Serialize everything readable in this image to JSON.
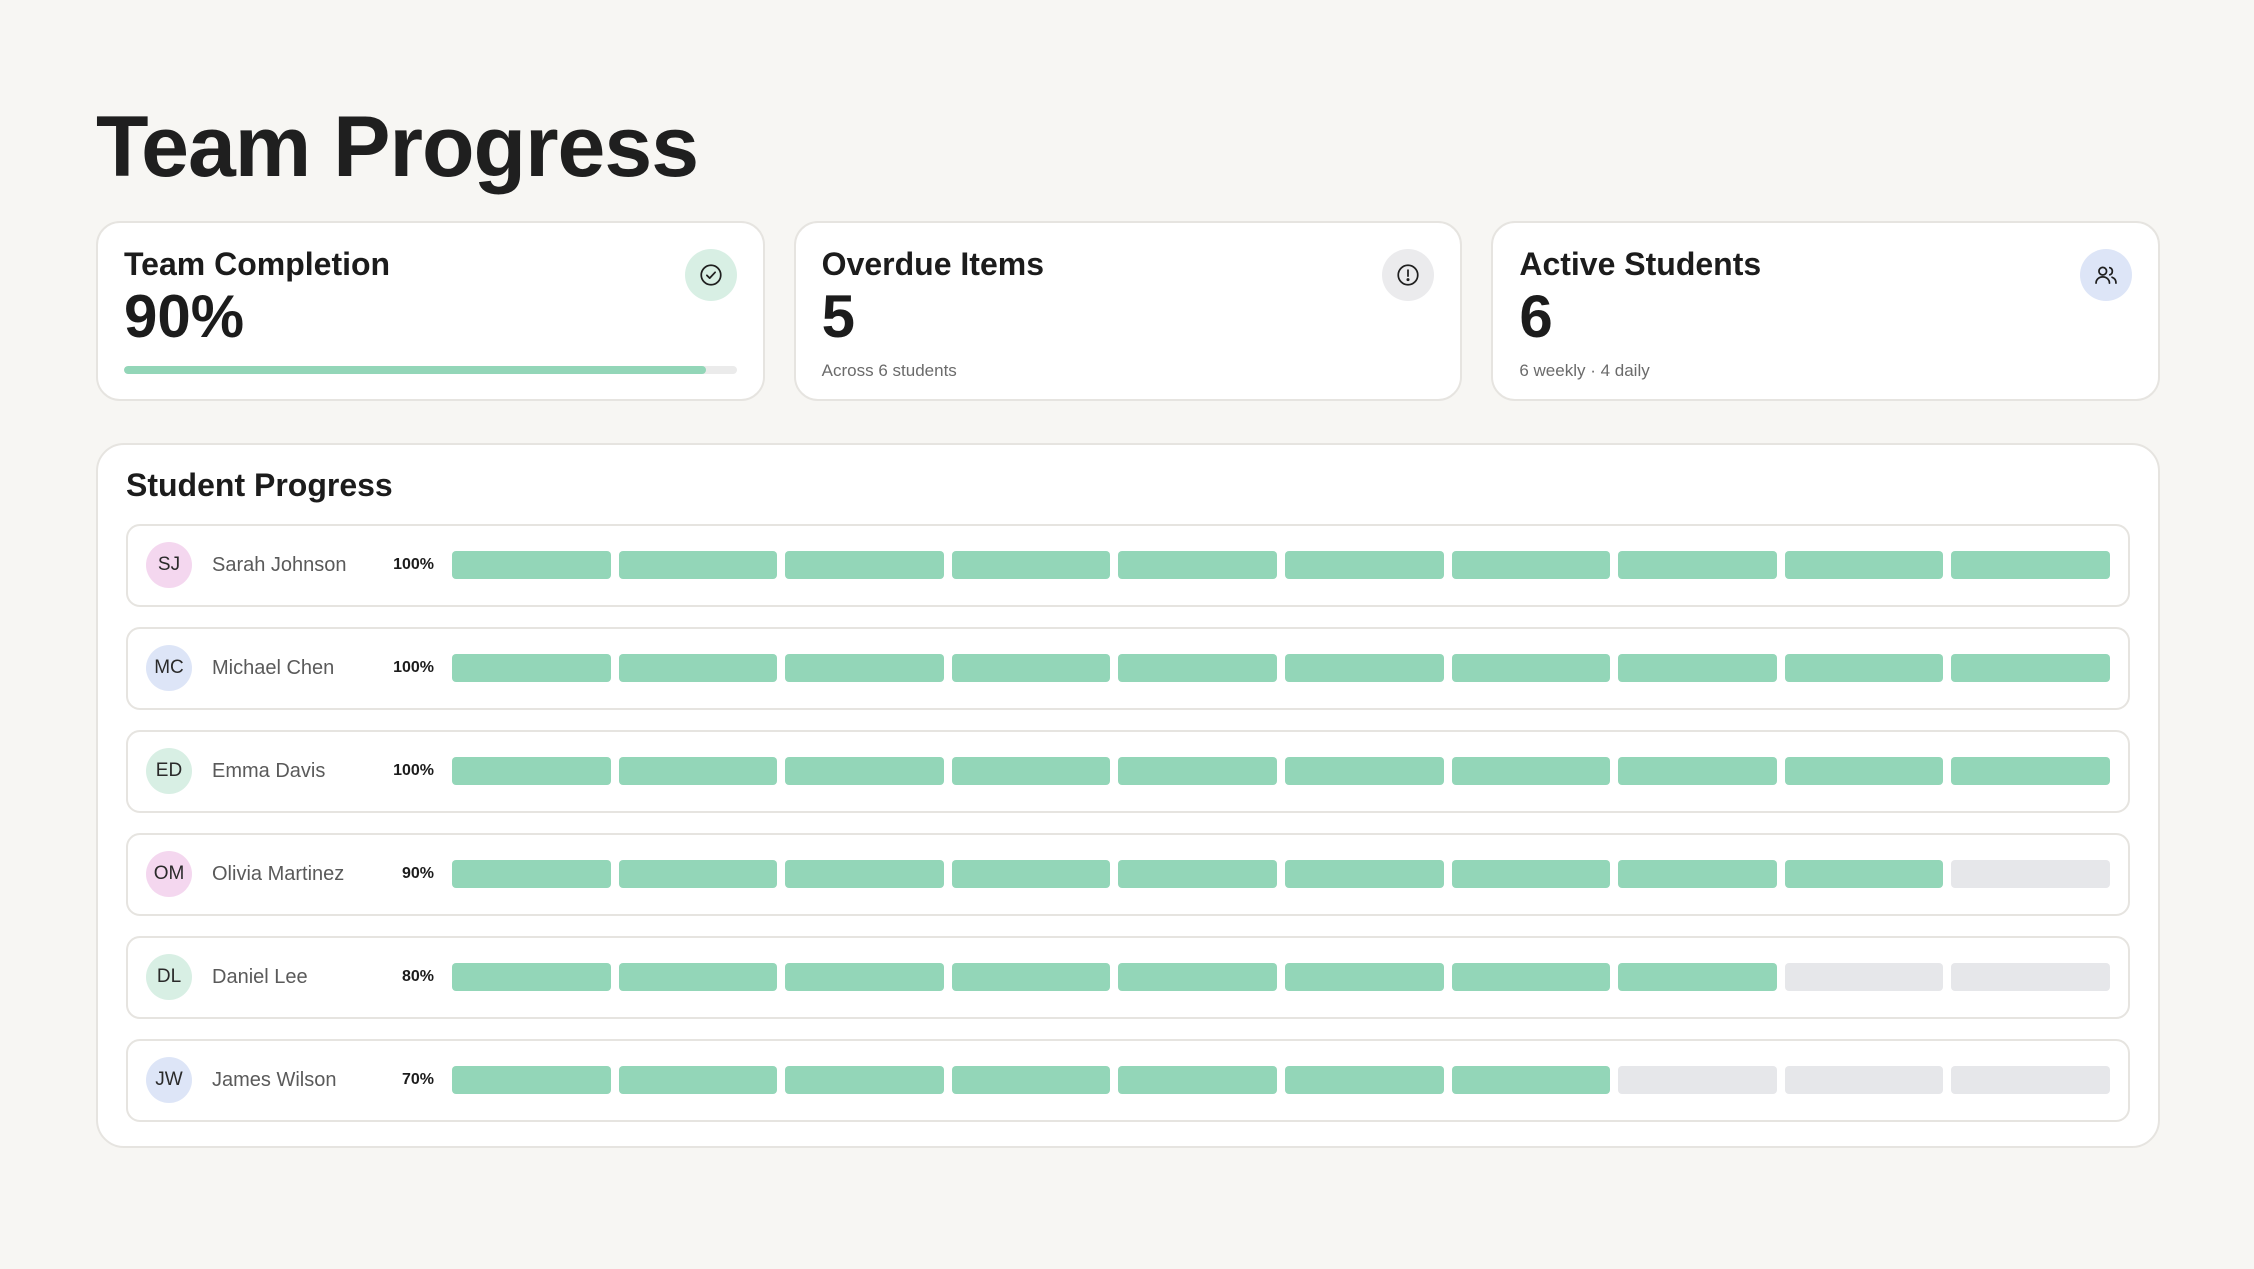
{
  "page": {
    "title": "Team Progress"
  },
  "colors": {
    "accent": "#93d6b8",
    "track": "#ebebeb",
    "segment_empty": "#e6e7ea",
    "icon_success_bg": "#d8efe4",
    "icon_neutral_bg": "#ebebed",
    "icon_info_bg": "#dde5f7"
  },
  "cards": {
    "completion": {
      "title": "Team Completion",
      "value": "90%",
      "progress": 0.95,
      "icon": "check-circle-icon"
    },
    "overdue": {
      "title": "Overdue Items",
      "value": "5",
      "subtitle": "Across 6 students",
      "icon": "alert-circle-icon"
    },
    "active": {
      "title": "Active Students",
      "value": "6",
      "subtitle": "6 weekly · 4 daily",
      "icon": "users-icon"
    }
  },
  "student_progress": {
    "title": "Student Progress",
    "segments_total": 10,
    "students": [
      {
        "initials": "SJ",
        "name": "Sarah Johnson",
        "percent": "100%",
        "completed": 10,
        "avatar_color": "#f4d7ef"
      },
      {
        "initials": "MC",
        "name": "Michael Chen",
        "percent": "100%",
        "completed": 10,
        "avatar_color": "#dde5f7"
      },
      {
        "initials": "ED",
        "name": "Emma Davis",
        "percent": "100%",
        "completed": 10,
        "avatar_color": "#d8efe4"
      },
      {
        "initials": "OM",
        "name": "Olivia Martinez",
        "percent": "90%",
        "completed": 9,
        "avatar_color": "#f4d7ef"
      },
      {
        "initials": "DL",
        "name": "Daniel Lee",
        "percent": "80%",
        "completed": 8,
        "avatar_color": "#d8efe4"
      },
      {
        "initials": "JW",
        "name": "James Wilson",
        "percent": "70%",
        "completed": 7,
        "avatar_color": "#dde5f7"
      }
    ]
  }
}
